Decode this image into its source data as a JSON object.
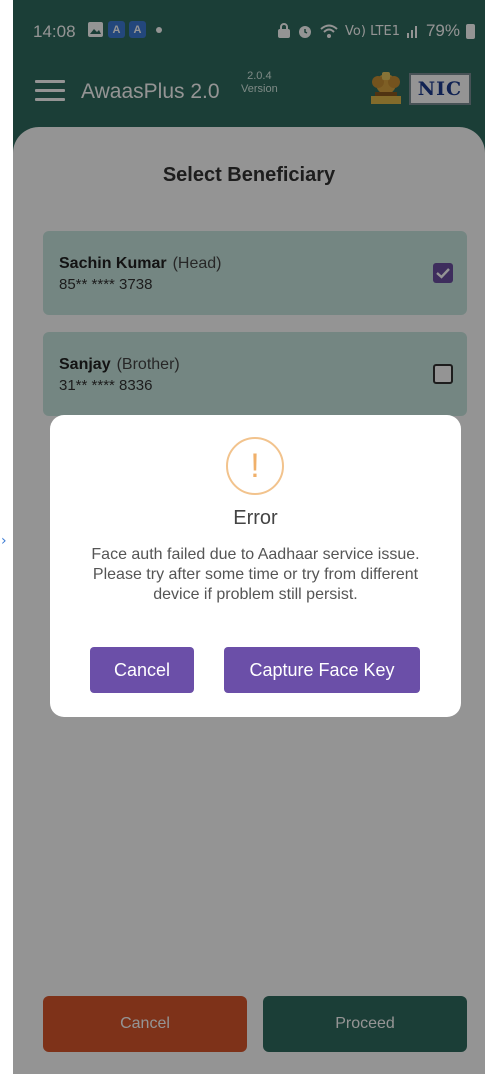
{
  "status_bar": {
    "time": "14:08",
    "icons": [
      "image-icon",
      "a-app-icon",
      "a-app-icon",
      "dot"
    ],
    "app_badges": [
      "A",
      "A"
    ],
    "network_label": "Vo) LTE1",
    "battery": "79%"
  },
  "app_bar": {
    "title": "AwaasPlus 2.0",
    "version_number": "2.0.4",
    "version_label": "Version",
    "logo_text": "NIC"
  },
  "screen": {
    "title": "Select Beneficiary",
    "beneficiaries": [
      {
        "name": "Sachin Kumar",
        "relation": "(Head)",
        "id_masked": "85** **** 3738",
        "checked": true
      },
      {
        "name": "Sanjay",
        "relation": "(Brother)",
        "id_masked": "31** **** 8336",
        "checked": false
      }
    ],
    "cancel_label": "Cancel",
    "proceed_label": "Proceed"
  },
  "dialog": {
    "icon": "!",
    "title": "Error",
    "message": "Face auth failed due to Aadhaar service issue. Please try after some time or try from different device if problem still persist.",
    "cancel_label": "Cancel",
    "capture_label": "Capture Face Key"
  },
  "colors": {
    "app_bar": "#2f6c5f",
    "card": "#c8e7e0",
    "checkbox": "#6b4fa0",
    "dialog_button": "#6b4fa8",
    "cancel_button": "#d9562c",
    "proceed_button": "#2f6c5f",
    "warning_icon": "#f0b06a"
  }
}
